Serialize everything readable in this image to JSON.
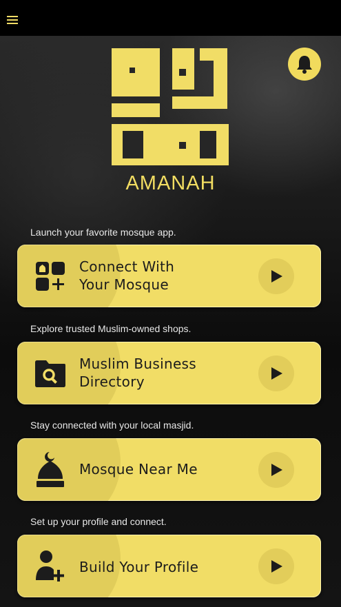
{
  "app": {
    "brand": "AMANAH"
  },
  "header": {
    "menu_icon": "hamburger-menu-icon",
    "notification_icon": "bell-icon"
  },
  "colors": {
    "accent": "#f1dd66",
    "background": "#0d0d0d",
    "topbar": "#000000",
    "text_dark": "#1c1c1c"
  },
  "sections": [
    {
      "caption": "Launch your favorite mosque app.",
      "label": "Connect With\nYour Mosque",
      "icon": "apps-add-icon",
      "action_icon": "play-arrow-icon"
    },
    {
      "caption": "Explore trusted Muslim-owned shops.",
      "label": "Muslim Business\nDirectory",
      "icon": "folder-search-icon",
      "action_icon": "play-arrow-icon"
    },
    {
      "caption": "Stay connected with your local masjid.",
      "label": "Mosque Near Me",
      "icon": "mosque-dome-icon",
      "action_icon": "play-arrow-icon"
    },
    {
      "caption": "Set up your profile and connect.",
      "label": "Build Your Profile",
      "icon": "add-person-icon",
      "action_icon": "play-arrow-icon"
    }
  ]
}
